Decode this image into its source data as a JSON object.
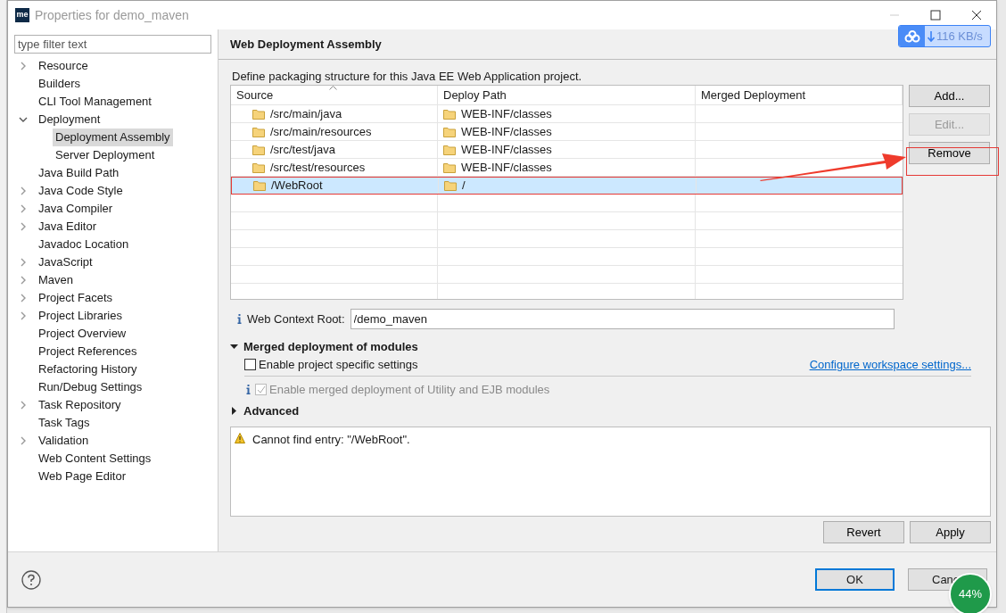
{
  "window": {
    "title": "Properties for demo_maven",
    "app_icon": "me"
  },
  "filter": {
    "placeholder": "type filter text"
  },
  "tree": [
    {
      "label": "Resource",
      "kind": "group",
      "expanded": false,
      "selected": false
    },
    {
      "label": "Builders",
      "kind": "leaf",
      "selected": false
    },
    {
      "label": "CLI Tool Management",
      "kind": "leaf",
      "selected": false
    },
    {
      "label": "Deployment",
      "kind": "group",
      "expanded": true,
      "selected": false,
      "children": [
        {
          "label": "Deployment Assembly",
          "kind": "leaf",
          "selected": true
        },
        {
          "label": "Server Deployment",
          "kind": "leaf",
          "selected": false
        }
      ]
    },
    {
      "label": "Java Build Path",
      "kind": "leaf",
      "selected": false
    },
    {
      "label": "Java Code Style",
      "kind": "group",
      "expanded": false,
      "selected": false
    },
    {
      "label": "Java Compiler",
      "kind": "group",
      "expanded": false,
      "selected": false
    },
    {
      "label": "Java Editor",
      "kind": "group",
      "expanded": false,
      "selected": false
    },
    {
      "label": "Javadoc Location",
      "kind": "leaf",
      "selected": false
    },
    {
      "label": "JavaScript",
      "kind": "group",
      "expanded": false,
      "selected": false
    },
    {
      "label": "Maven",
      "kind": "group",
      "expanded": false,
      "selected": false
    },
    {
      "label": "Project Facets",
      "kind": "group",
      "expanded": false,
      "selected": false
    },
    {
      "label": "Project Libraries",
      "kind": "group",
      "expanded": false,
      "selected": false
    },
    {
      "label": "Project Overview",
      "kind": "leaf",
      "selected": false
    },
    {
      "label": "Project References",
      "kind": "leaf",
      "selected": false
    },
    {
      "label": "Refactoring History",
      "kind": "leaf",
      "selected": false
    },
    {
      "label": "Run/Debug Settings",
      "kind": "leaf",
      "selected": false
    },
    {
      "label": "Task Repository",
      "kind": "group",
      "expanded": false,
      "selected": false
    },
    {
      "label": "Task Tags",
      "kind": "leaf",
      "selected": false
    },
    {
      "label": "Validation",
      "kind": "group",
      "expanded": false,
      "selected": false
    },
    {
      "label": "Web Content Settings",
      "kind": "leaf",
      "selected": false
    },
    {
      "label": "Web Page Editor",
      "kind": "leaf",
      "selected": false
    }
  ],
  "page": {
    "title": "Web Deployment Assembly",
    "description": "Define packaging structure for this Java EE Web Application project."
  },
  "table": {
    "columns": [
      "Source",
      "Deploy Path",
      "Merged Deployment"
    ],
    "rows": [
      {
        "source": "/src/main/java",
        "deploy_path": "WEB-INF/classes",
        "selected": false
      },
      {
        "source": "/src/main/resources",
        "deploy_path": "WEB-INF/classes",
        "selected": false
      },
      {
        "source": "/src/test/java",
        "deploy_path": "WEB-INF/classes",
        "selected": false
      },
      {
        "source": "/src/test/resources",
        "deploy_path": "WEB-INF/classes",
        "selected": false
      },
      {
        "source": "/WebRoot",
        "deploy_path": "/",
        "selected": true
      }
    ]
  },
  "side_buttons": [
    {
      "label": "Add...",
      "disabled": false
    },
    {
      "label": "Edit...",
      "disabled": true
    },
    {
      "label": "Remove",
      "disabled": false
    }
  ],
  "context_root": {
    "label": "Web Context Root:",
    "value": "/demo_maven"
  },
  "merged": {
    "title": "Merged deployment of modules",
    "expanded": true,
    "enable_label": "Enable project specific settings",
    "enable_checked": false,
    "link": "Configure workspace settings...",
    "merged_label": "Enable merged deployment of Utility and EJB modules",
    "merged_checked": true
  },
  "advanced": {
    "title": "Advanced",
    "expanded": false
  },
  "message": "Cannot find entry: \"/WebRoot\".",
  "page_buttons": [
    "Revert",
    "Apply"
  ],
  "dialog_buttons": [
    {
      "label": "OK",
      "default": true
    },
    {
      "label": "Canc",
      "default": false
    }
  ],
  "speed_widget": {
    "text": "116 KB/s"
  },
  "memory_ball": {
    "text": "44%"
  }
}
